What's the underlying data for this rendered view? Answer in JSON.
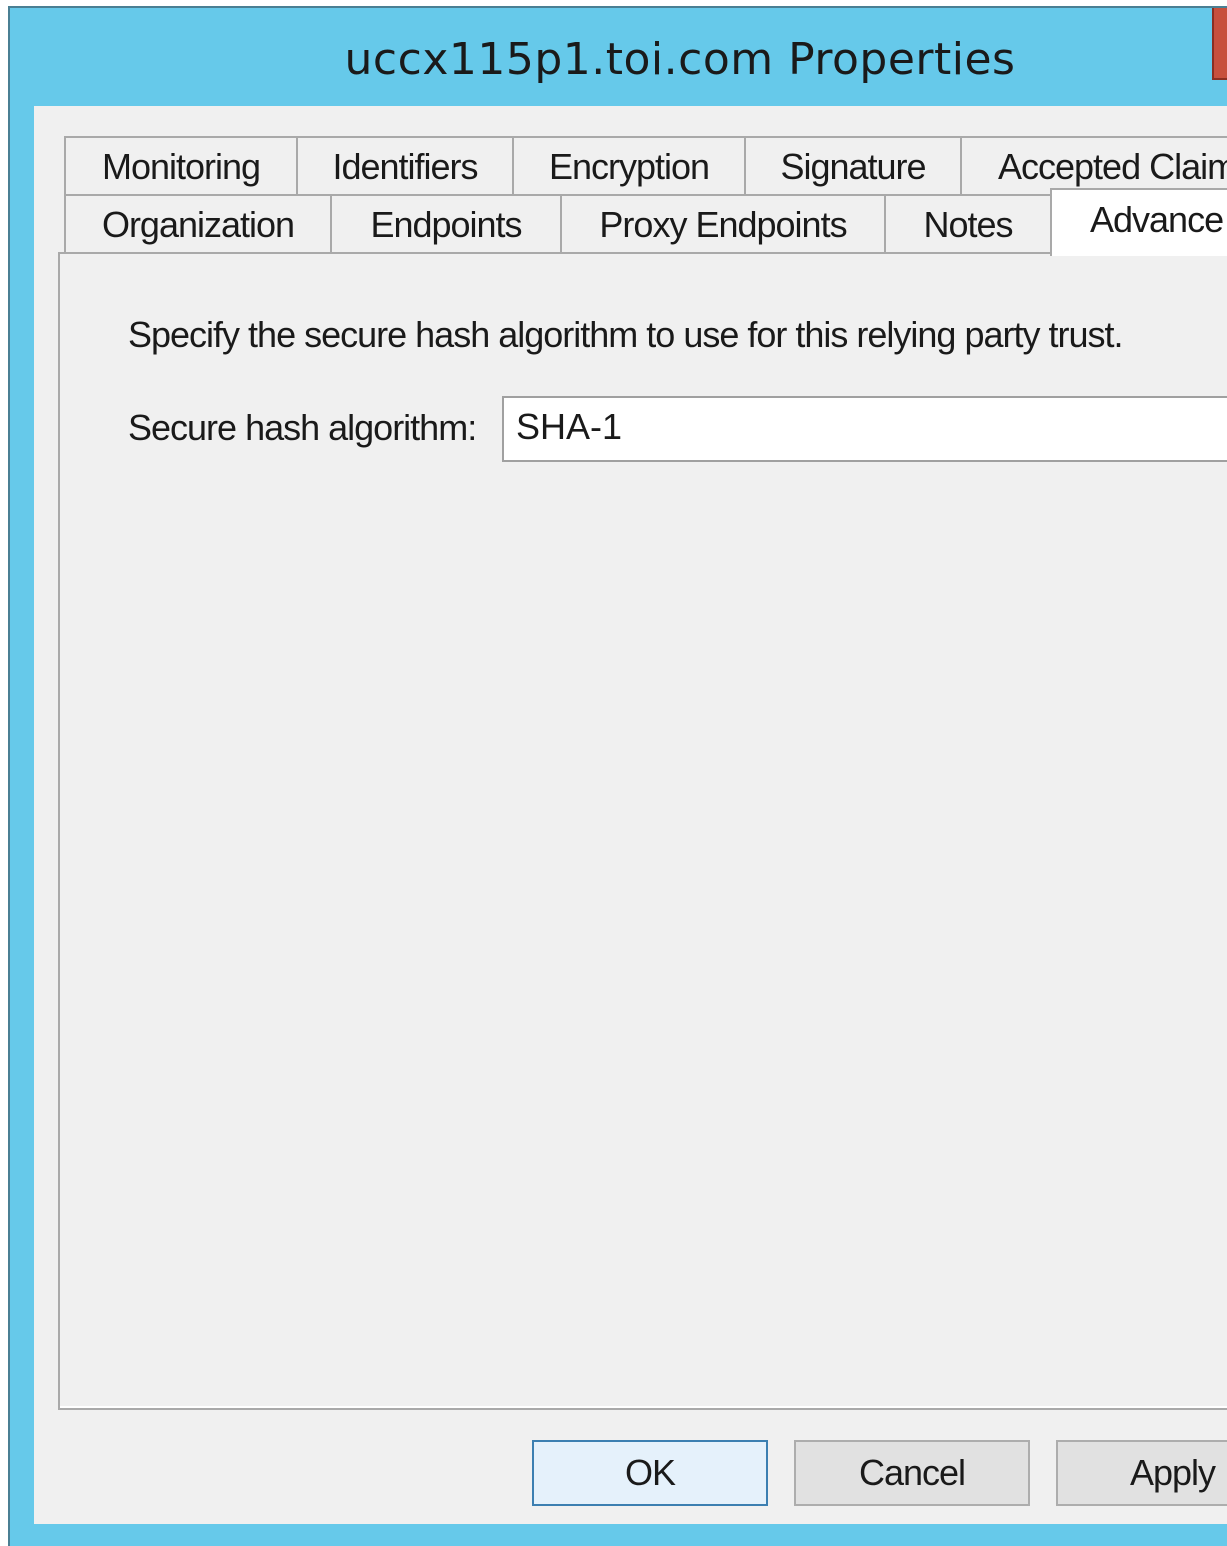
{
  "window": {
    "title": "uccx115p1.toi.com Properties"
  },
  "tabs": {
    "row1": [
      {
        "label": "Monitoring"
      },
      {
        "label": "Identifiers"
      },
      {
        "label": "Encryption"
      },
      {
        "label": "Signature"
      },
      {
        "label": "Accepted Claim"
      }
    ],
    "row2": [
      {
        "label": "Organization"
      },
      {
        "label": "Endpoints"
      },
      {
        "label": "Proxy Endpoints"
      },
      {
        "label": "Notes"
      },
      {
        "label": "Advance"
      }
    ],
    "active": "Advance"
  },
  "panel": {
    "description": "Specify the secure hash algorithm to use for this relying party trust.",
    "hash_label": "Secure hash algorithm:",
    "hash_value": "SHA-1"
  },
  "buttons": {
    "ok": "OK",
    "cancel": "Cancel",
    "apply": "Apply"
  },
  "colors": {
    "titlebar": "#66c9ea",
    "close": "#c7503d",
    "dialog": "#f0f0f0",
    "default_button_border": "#3c7fb1"
  },
  "icons": {
    "dropdown": "chevron-down-icon",
    "close": "close-icon"
  }
}
